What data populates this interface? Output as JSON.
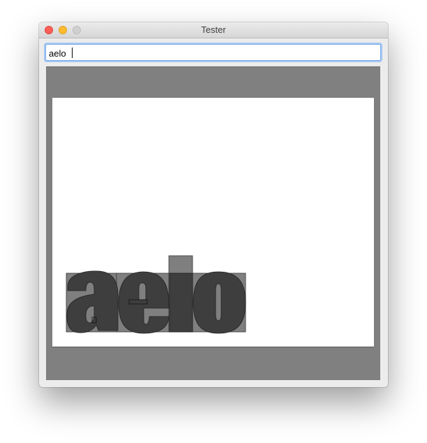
{
  "window": {
    "title": "Tester"
  },
  "input": {
    "value": "aelo"
  },
  "preview": {
    "glyph_text": "aelo",
    "glyphs": [
      {
        "char": "a"
      },
      {
        "char": "e"
      },
      {
        "char": "l"
      },
      {
        "char": "o"
      }
    ]
  }
}
